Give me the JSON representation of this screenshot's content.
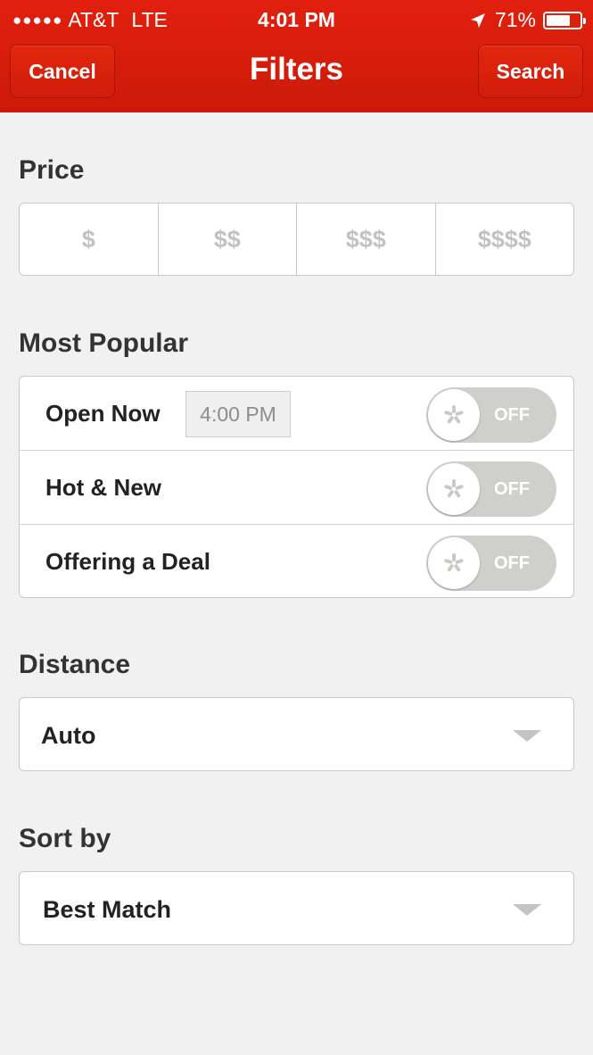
{
  "status_bar": {
    "signal_dots": "●●●●●",
    "carrier": "AT&T",
    "network": "LTE",
    "time": "4:01 PM",
    "battery": "71%",
    "battery_level": 0.71
  },
  "header": {
    "cancel_label": "Cancel",
    "title": "Filters",
    "search_label": "Search"
  },
  "price": {
    "title": "Price",
    "options": [
      "$",
      "$$",
      "$$$",
      "$$$$"
    ]
  },
  "popular": {
    "title": "Most Popular",
    "items": [
      {
        "label": "Open Now",
        "time": "4:00 PM",
        "toggle": "OFF"
      },
      {
        "label": "Hot & New",
        "toggle": "OFF"
      },
      {
        "label": "Offering a Deal",
        "toggle": "OFF"
      }
    ]
  },
  "distance": {
    "title": "Distance",
    "value": "Auto"
  },
  "sort": {
    "title": "Sort by",
    "value": "Best Match"
  },
  "colors": {
    "header_red": "#d81c0b",
    "toggle_off": "#cfd0cb",
    "background": "#f1f1f1"
  },
  "icons": {
    "toggle_knob": "yelp-burst-icon",
    "location": "location-arrow-icon",
    "dropdown": "caret-down-icon"
  }
}
